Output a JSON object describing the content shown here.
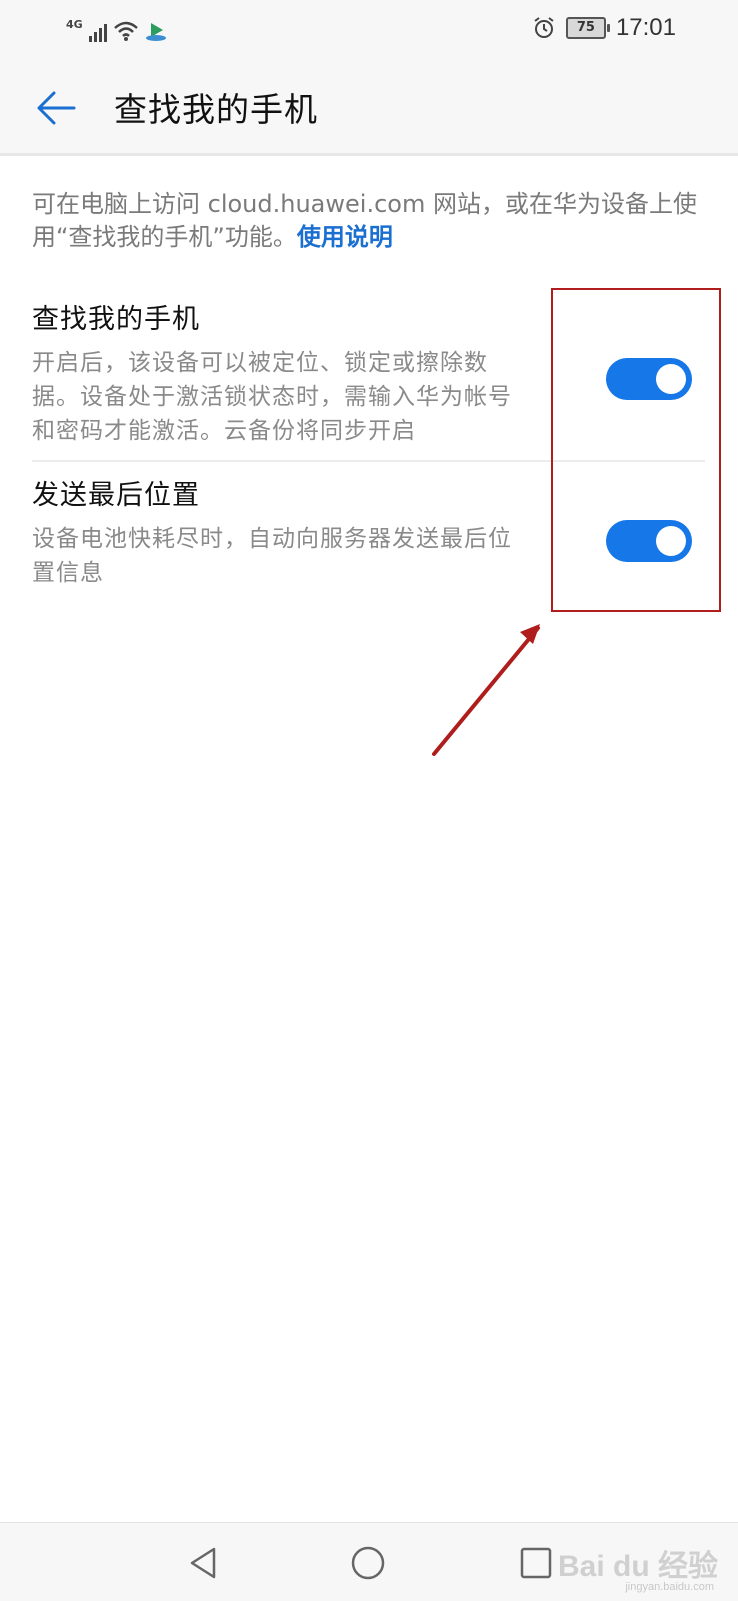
{
  "status_bar": {
    "network_label": "4G",
    "signal_icon": "signal-bars-icon",
    "wifi_icon": "wifi-icon",
    "app_icon": "app-notification-icon",
    "alarm_icon": "alarm-clock-icon",
    "battery_level": "75",
    "time": "17:01"
  },
  "header": {
    "back_icon": "back-arrow-icon",
    "title": "查找我的手机"
  },
  "intro": {
    "text": "可在电脑上访问 cloud.huawei.com 网站，或在华为设备上使用“查找我的手机”功能。",
    "link_label": "使用说明"
  },
  "settings": [
    {
      "title": "查找我的手机",
      "description": "开启后，该设备可以被定位、锁定或擦除数据。设备处于激活锁状态时，需输入华为帐号和密码才能激活。云备份将同步开启",
      "enabled": true
    },
    {
      "title": "发送最后位置",
      "description": "设备电池快耗尽时，自动向服务器发送最后位置信息",
      "enabled": true
    }
  ],
  "navbar": {
    "back_icon": "triangle-back-icon",
    "home_icon": "circle-home-icon",
    "recent_icon": "square-recent-icon"
  },
  "watermark": {
    "brand": "Bai du 经验",
    "url": "jingyan.baidu.com"
  },
  "colors": {
    "accent": "#1677e8",
    "link": "#1a6fd0",
    "annotation": "#b01d1d"
  }
}
